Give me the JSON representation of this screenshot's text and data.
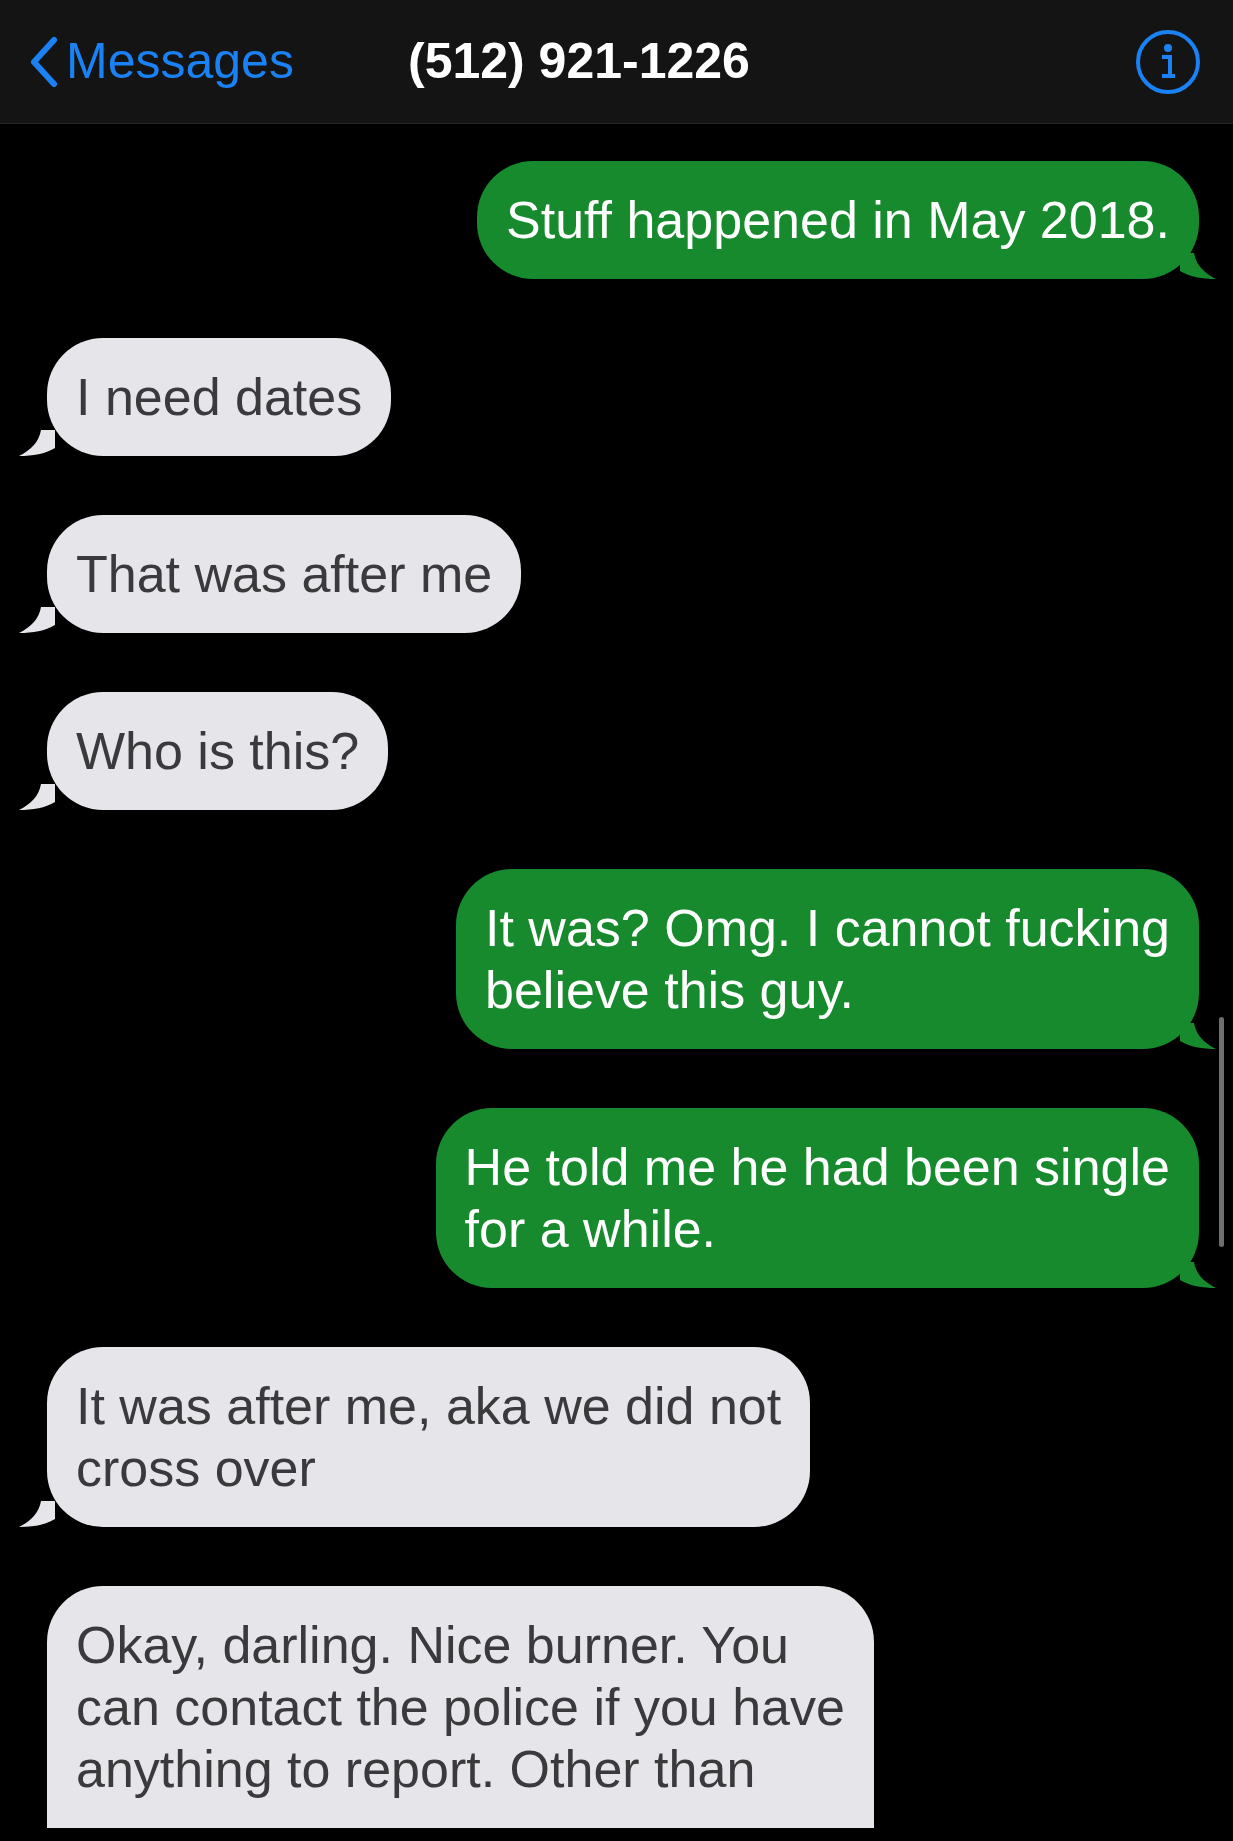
{
  "nav": {
    "back": "Messages",
    "title": "(512) 921-1226"
  },
  "messages": [
    {
      "kind": "sent",
      "text": "Stuff happened in May 2018."
    },
    {
      "kind": "received",
      "text": "I need dates"
    },
    {
      "kind": "received",
      "text": "That was after me"
    },
    {
      "kind": "received",
      "text": "Who is this?"
    },
    {
      "kind": "sent",
      "text": "It was? Omg. I cannot fucking\nbelieve this guy."
    },
    {
      "kind": "sent",
      "text": "He told me he had been single\nfor a while."
    },
    {
      "kind": "received",
      "text": "It was after me, aka we did not\ncross over"
    },
    {
      "kind": "received",
      "text": "Okay, darling. Nice burner. You\ncan contact the police if you have\nanything to report. Other than"
    }
  ]
}
